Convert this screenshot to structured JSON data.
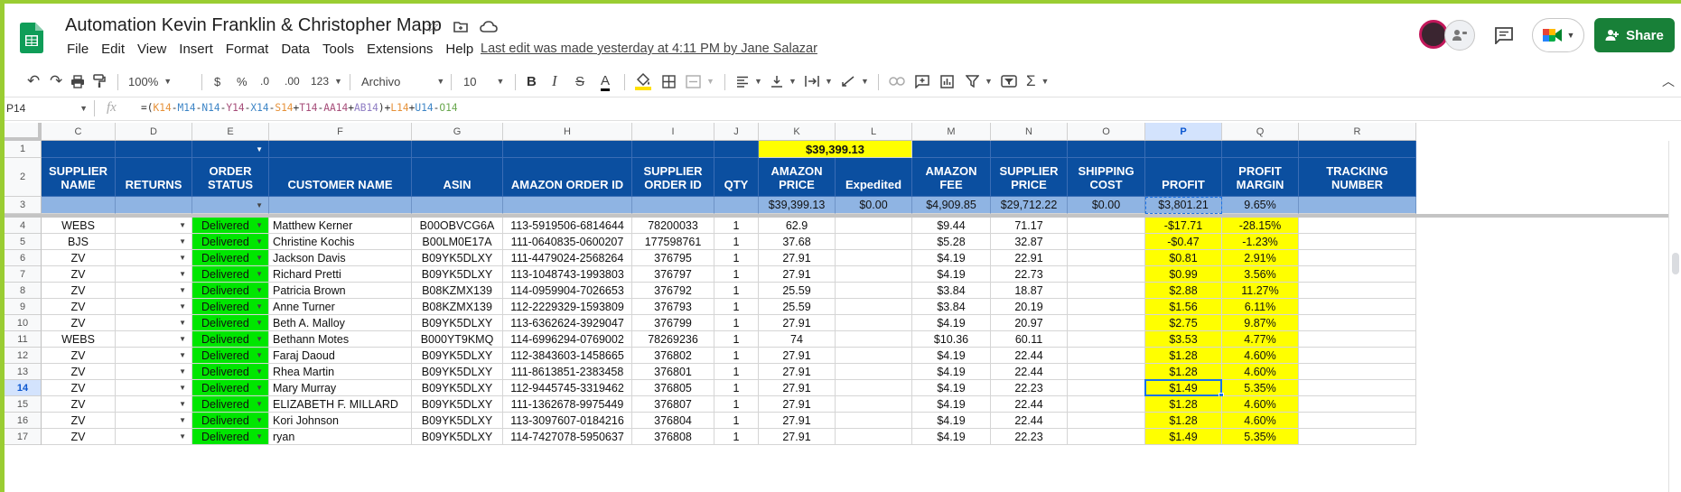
{
  "window": {
    "title": "Automation Kevin Franklin & Christopher Mapp",
    "last_edit": "Last edit was made yesterday at 4:11 PM by Jane Salazar",
    "share_label": "Share"
  },
  "menu": [
    "File",
    "Edit",
    "View",
    "Insert",
    "Format",
    "Data",
    "Tools",
    "Extensions",
    "Help"
  ],
  "toolbar": {
    "zoom": "100%",
    "currency": "$",
    "percent": "%",
    "dec_decrease": ".0",
    "dec_increase": ".00",
    "more_formats": "123",
    "font": "Archivo",
    "font_size": "10",
    "bold": "B",
    "italic": "I",
    "strike": "S",
    "text_color": "A",
    "sigma": "Σ"
  },
  "formula_bar": {
    "cell_ref": "P14",
    "fx": "fx",
    "formula_parts": [
      {
        "t": "=(",
        "c": ""
      },
      {
        "t": "K14",
        "c": "c1"
      },
      {
        "t": "-",
        "c": ""
      },
      {
        "t": "M14",
        "c": "c3"
      },
      {
        "t": "-",
        "c": ""
      },
      {
        "t": "N14",
        "c": "c3"
      },
      {
        "t": "-",
        "c": ""
      },
      {
        "t": "Y14",
        "c": "c4"
      },
      {
        "t": "-",
        "c": ""
      },
      {
        "t": "X14",
        "c": "c3"
      },
      {
        "t": "-",
        "c": ""
      },
      {
        "t": "S14",
        "c": "c1"
      },
      {
        "t": "+",
        "c": ""
      },
      {
        "t": "T14",
        "c": "c4"
      },
      {
        "t": "-",
        "c": ""
      },
      {
        "t": "AA14",
        "c": "c4"
      },
      {
        "t": "+",
        "c": ""
      },
      {
        "t": "AB14",
        "c": "c5"
      },
      {
        "t": ")+",
        "c": ""
      },
      {
        "t": "L14",
        "c": "c1"
      },
      {
        "t": "+",
        "c": ""
      },
      {
        "t": "U14",
        "c": "c3"
      },
      {
        "t": "-",
        "c": ""
      },
      {
        "t": "O14",
        "c": "c2"
      }
    ]
  },
  "columns": [
    "C",
    "D",
    "E",
    "F",
    "G",
    "H",
    "I",
    "J",
    "K",
    "L",
    "M",
    "N",
    "O",
    "P",
    "Q",
    "R"
  ],
  "row1_total": "$39,399.13",
  "headers": [
    "SUPPLIER NAME",
    "RETURNS",
    "ORDER STATUS",
    "CUSTOMER NAME",
    "ASIN",
    "AMAZON ORDER ID",
    "SUPPLIER ORDER ID",
    "QTY",
    "AMAZON PRICE",
    "Expedited",
    "AMAZON FEE",
    "SUPPLIER PRICE",
    "SHIPPING COST",
    "PROFIT",
    "PROFIT MARGIN",
    "TRACKING NUMBER"
  ],
  "totals": {
    "K": "$39,399.13",
    "L": "$0.00",
    "M": "$4,909.85",
    "N": "$29,712.22",
    "O": "$0.00",
    "P": "$3,801.21",
    "Q": "9.65%"
  },
  "rows": [
    {
      "n": "4",
      "supplier": "WEBS",
      "status": "Delivered",
      "customer": "Matthew Kerner",
      "asin": "B00OBVCG6A",
      "order_id": "113-5919506-6814644",
      "sup_id": "78200033",
      "qty": "1",
      "price": "62.9",
      "exp": "",
      "fee": "$9.44",
      "sprice": "71.17",
      "ship": "",
      "profit": "-$17.71",
      "margin": "-28.15%"
    },
    {
      "n": "5",
      "supplier": "BJS",
      "status": "Delivered",
      "customer": "Christine Kochis",
      "asin": "B00LM0E17A",
      "order_id": "111-0640835-0600207",
      "sup_id": "177598761",
      "qty": "1",
      "price": "37.68",
      "exp": "",
      "fee": "$5.28",
      "sprice": "32.87",
      "ship": "",
      "profit": "-$0.47",
      "margin": "-1.23%"
    },
    {
      "n": "6",
      "supplier": "ZV",
      "status": "Delivered",
      "customer": "Jackson Davis",
      "asin": "B09YK5DLXY",
      "order_id": "111-4479024-2568264",
      "sup_id": "376795",
      "qty": "1",
      "price": "27.91",
      "exp": "",
      "fee": "$4.19",
      "sprice": "22.91",
      "ship": "",
      "profit": "$0.81",
      "margin": "2.91%"
    },
    {
      "n": "7",
      "supplier": "ZV",
      "status": "Delivered",
      "customer": "Richard Pretti",
      "asin": "B09YK5DLXY",
      "order_id": "113-1048743-1993803",
      "sup_id": "376797",
      "qty": "1",
      "price": "27.91",
      "exp": "",
      "fee": "$4.19",
      "sprice": "22.73",
      "ship": "",
      "profit": "$0.99",
      "margin": "3.56%"
    },
    {
      "n": "8",
      "supplier": "ZV",
      "status": "Delivered",
      "customer": "Patricia Brown",
      "asin": "B08KZMX139",
      "order_id": "114-0959904-7026653",
      "sup_id": "376792",
      "qty": "1",
      "price": "25.59",
      "exp": "",
      "fee": "$3.84",
      "sprice": "18.87",
      "ship": "",
      "profit": "$2.88",
      "margin": "11.27%"
    },
    {
      "n": "9",
      "supplier": "ZV",
      "status": "Delivered",
      "customer": "Anne Turner",
      "asin": "B08KZMX139",
      "order_id": "112-2229329-1593809",
      "sup_id": "376793",
      "qty": "1",
      "price": "25.59",
      "exp": "",
      "fee": "$3.84",
      "sprice": "20.19",
      "ship": "",
      "profit": "$1.56",
      "margin": "6.11%"
    },
    {
      "n": "10",
      "supplier": "ZV",
      "status": "Delivered",
      "customer": "Beth A. Malloy",
      "asin": "B09YK5DLXY",
      "order_id": "113-6362624-3929047",
      "sup_id": "376799",
      "qty": "1",
      "price": "27.91",
      "exp": "",
      "fee": "$4.19",
      "sprice": "20.97",
      "ship": "",
      "profit": "$2.75",
      "margin": "9.87%"
    },
    {
      "n": "11",
      "supplier": "WEBS",
      "status": "Delivered",
      "customer": "Bethann Motes",
      "asin": "B000YT9KMQ",
      "order_id": "114-6996294-0769002",
      "sup_id": "78269236",
      "qty": "1",
      "price": "74",
      "exp": "",
      "fee": "$10.36",
      "sprice": "60.11",
      "ship": "",
      "profit": "$3.53",
      "margin": "4.77%"
    },
    {
      "n": "12",
      "supplier": "ZV",
      "status": "Delivered",
      "customer": "Faraj Daoud",
      "asin": "B09YK5DLXY",
      "order_id": "112-3843603-1458665",
      "sup_id": "376802",
      "qty": "1",
      "price": "27.91",
      "exp": "",
      "fee": "$4.19",
      "sprice": "22.44",
      "ship": "",
      "profit": "$1.28",
      "margin": "4.60%"
    },
    {
      "n": "13",
      "supplier": "ZV",
      "status": "Delivered",
      "customer": "Rhea Martin",
      "asin": "B09YK5DLXY",
      "order_id": "111-8613851-2383458",
      "sup_id": "376801",
      "qty": "1",
      "price": "27.91",
      "exp": "",
      "fee": "$4.19",
      "sprice": "22.44",
      "ship": "",
      "profit": "$1.28",
      "margin": "4.60%"
    },
    {
      "n": "14",
      "supplier": "ZV",
      "status": "Delivered",
      "customer": "Mary Murray",
      "asin": "B09YK5DLXY",
      "order_id": "112-9445745-3319462",
      "sup_id": "376805",
      "qty": "1",
      "price": "27.91",
      "exp": "",
      "fee": "$4.19",
      "sprice": "22.23",
      "ship": "",
      "profit": "$1.49",
      "margin": "5.35%"
    },
    {
      "n": "15",
      "supplier": "ZV",
      "status": "Delivered",
      "customer": "ELIZABETH F. MILLARD",
      "asin": "B09YK5DLXY",
      "order_id": "111-1362678-9975449",
      "sup_id": "376807",
      "qty": "1",
      "price": "27.91",
      "exp": "",
      "fee": "$4.19",
      "sprice": "22.44",
      "ship": "",
      "profit": "$1.28",
      "margin": "4.60%"
    },
    {
      "n": "16",
      "supplier": "ZV",
      "status": "Delivered",
      "customer": "Kori Johnson",
      "asin": "B09YK5DLXY",
      "order_id": "113-3097607-0184216",
      "sup_id": "376804",
      "qty": "1",
      "price": "27.91",
      "exp": "",
      "fee": "$4.19",
      "sprice": "22.44",
      "ship": "",
      "profit": "$1.28",
      "margin": "4.60%"
    },
    {
      "n": "17",
      "supplier": "ZV",
      "status": "Delivered",
      "customer": "ryan",
      "asin": "B09YK5DLXY",
      "order_id": "114-7427078-5950637",
      "sup_id": "376808",
      "qty": "1",
      "price": "27.91",
      "exp": "",
      "fee": "$4.19",
      "sprice": "22.23",
      "ship": "",
      "profit": "$1.49",
      "margin": "5.35%"
    }
  ],
  "colors": {
    "header_blue": "#0b4fa0",
    "totals_blue": "#8fb4e3",
    "status_green": "#00e600",
    "highlight_yellow": "#ffff00",
    "share_green": "#188038"
  }
}
